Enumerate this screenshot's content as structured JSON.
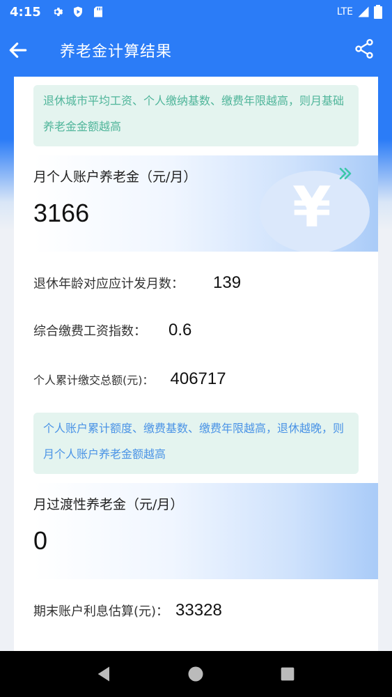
{
  "status": {
    "time": "4:15",
    "network": "LTE"
  },
  "header": {
    "title": "养老金计算结果"
  },
  "tip_basic": "退休城市平均工资、个人缴纳基数、缴费年限越高，则月基础养老金金额越高",
  "personal_account": {
    "label": "月个人账户养老金（元/月）",
    "value": "3166",
    "coin_symbol": "¥"
  },
  "details": [
    {
      "label": "退休年龄对应应计发月数：",
      "value": "139"
    },
    {
      "label": "综合缴费工资指数：",
      "value": "0.6"
    },
    {
      "label": "个人累计缴交总额(元)：",
      "value": "406717"
    }
  ],
  "tip_account": "个人账户累计额度、缴费基数、缴费年限越高，退休越晚，则月个人账户养老金额越高",
  "transition_pension": {
    "label": "月过渡性养老金（元/月）",
    "value": "0"
  },
  "interest": {
    "label": "期末账户利息估算(元)：",
    "value": "33328"
  },
  "colors": {
    "primary": "#2b7cf7",
    "tip_green_text": "#4fb59a",
    "tip_blue_text": "#4a93e6",
    "tip_bg": "#e4f4ef"
  }
}
